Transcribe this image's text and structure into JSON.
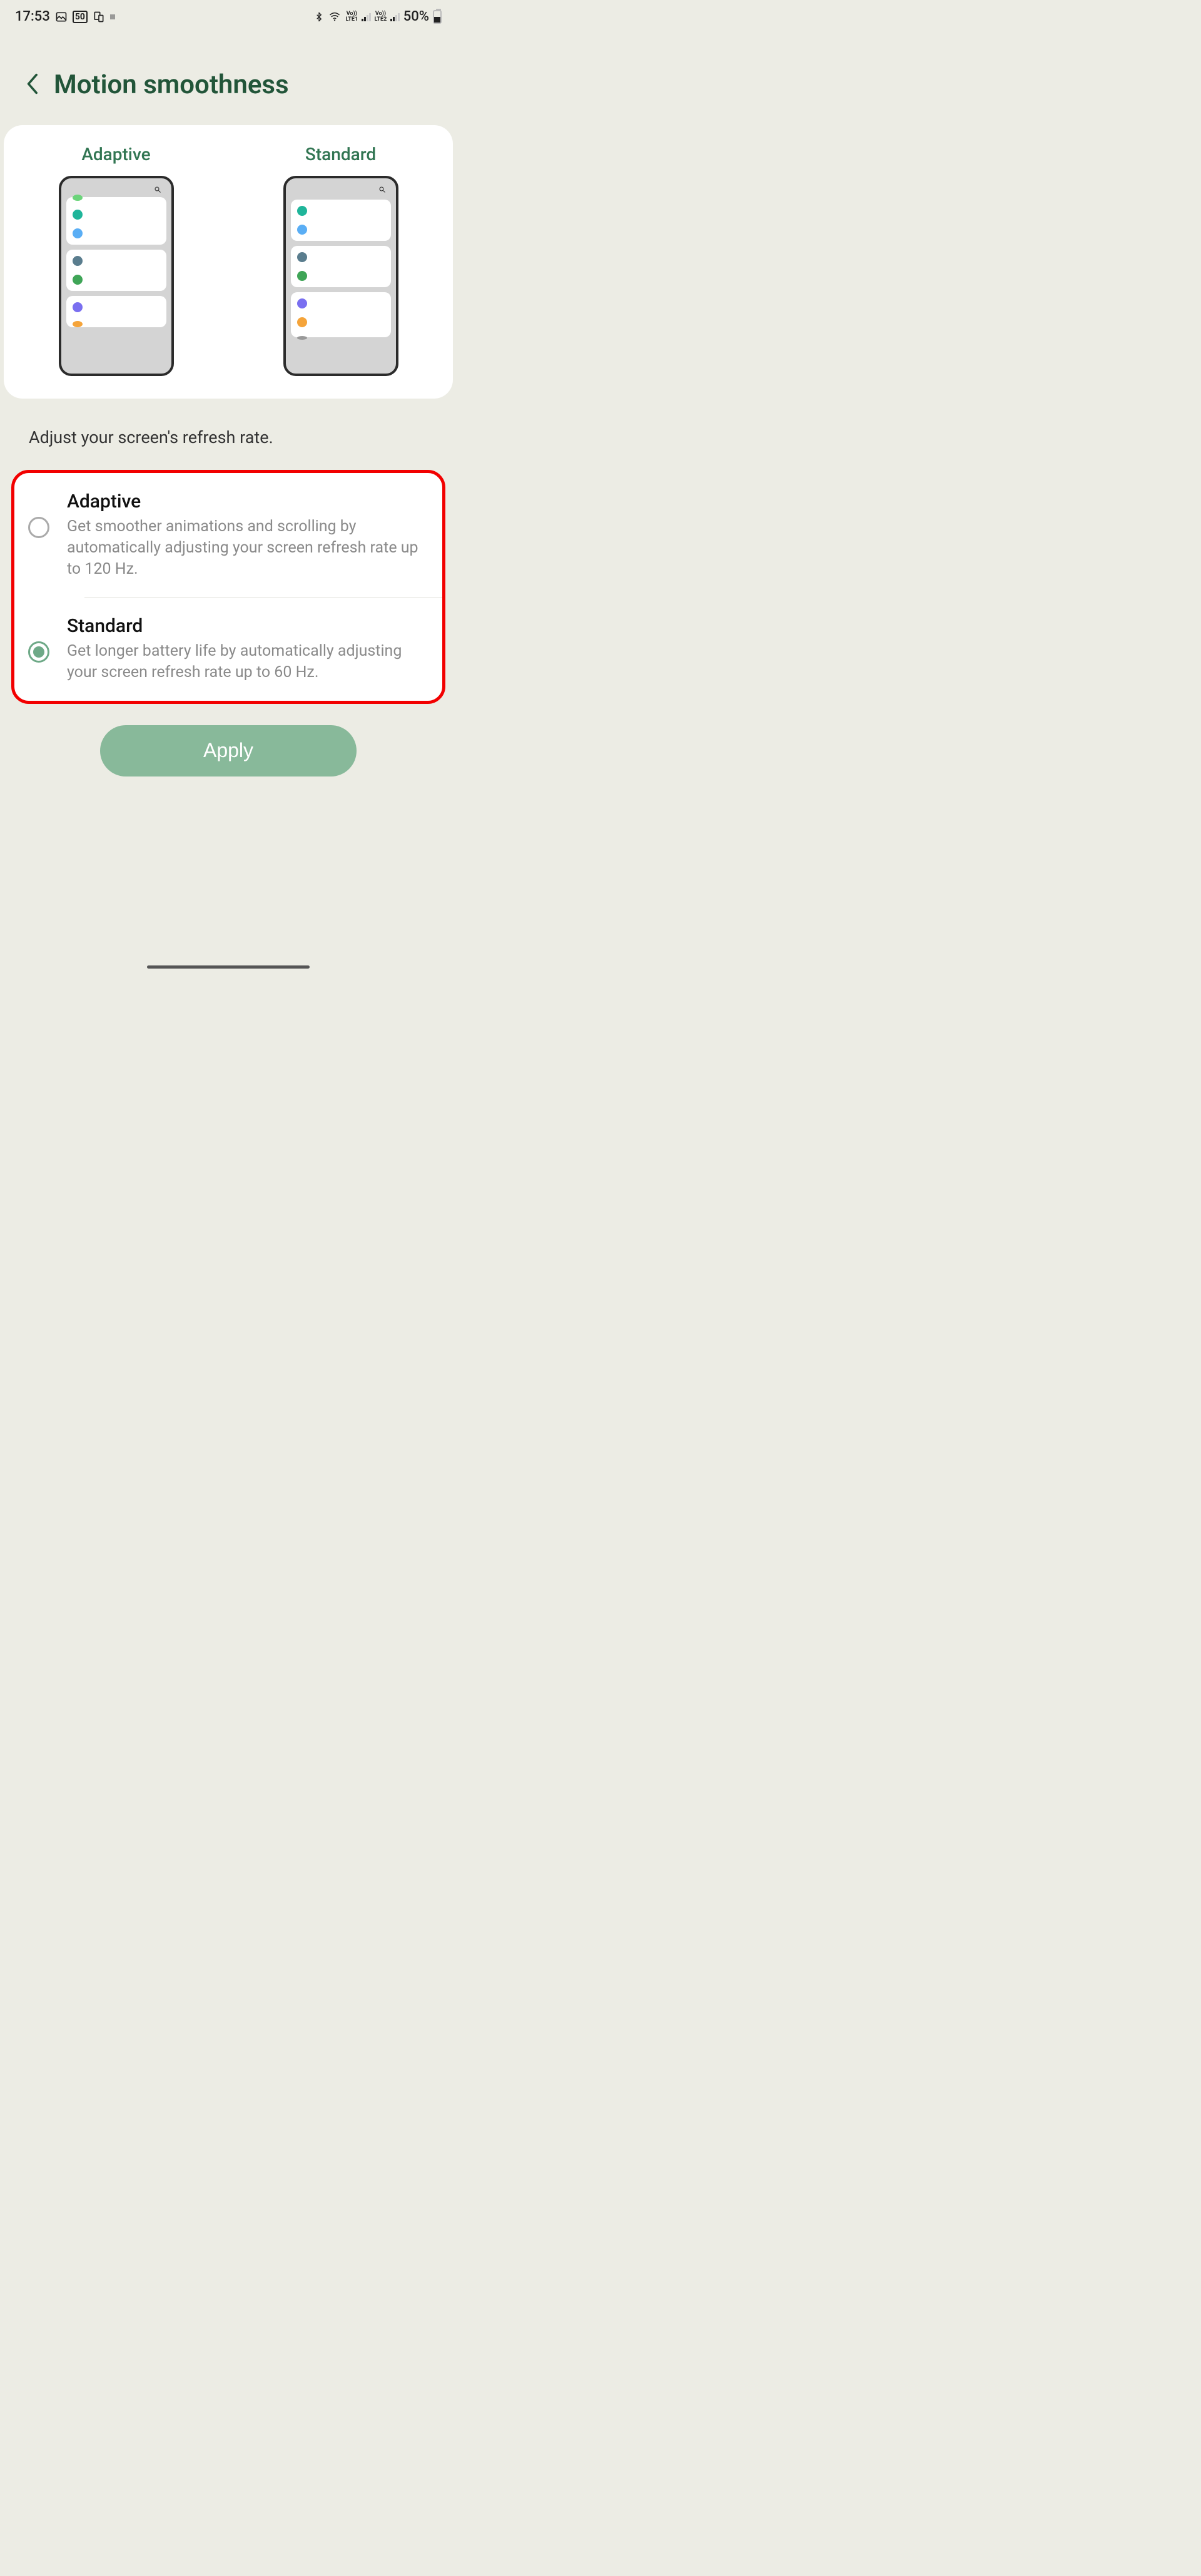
{
  "status": {
    "time": "17:53",
    "battery": "50%"
  },
  "page": {
    "title": "Motion smoothness",
    "subtitle": "Adjust your screen's refresh rate."
  },
  "preview": {
    "adaptiveLabel": "Adaptive",
    "standardLabel": "Standard"
  },
  "options": {
    "adaptive": {
      "title": "Adaptive",
      "desc": "Get smoother animations and scrolling by automatically adjusting your screen refresh rate up to 120 Hz."
    },
    "standard": {
      "title": "Standard",
      "desc": "Get longer battery life by automatically adjusting your screen refresh rate up to 60 Hz."
    },
    "selected": "standard"
  },
  "buttons": {
    "apply": "Apply"
  }
}
